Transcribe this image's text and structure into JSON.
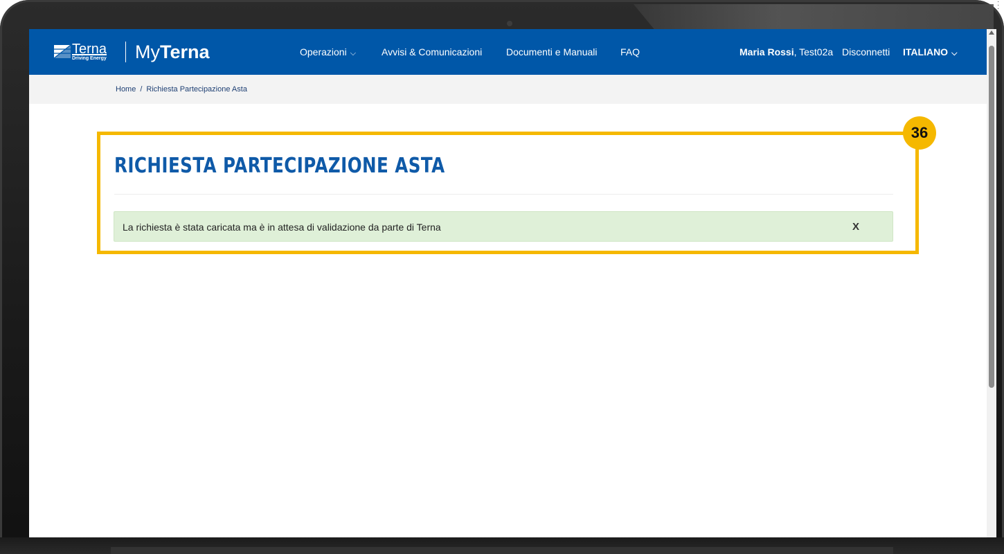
{
  "brand": {
    "logo_name": "Terna",
    "logo_tagline": "Driving Energy",
    "portal_prefix": "My",
    "portal_name": "Terna"
  },
  "nav": {
    "items": [
      {
        "label": "Operazioni",
        "has_dropdown": true
      },
      {
        "label": "Avvisi & Comunicazioni"
      },
      {
        "label": "Documenti e Manuali"
      },
      {
        "label": "FAQ"
      }
    ],
    "user_name": "Maria Rossi",
    "user_account": ", Test02a",
    "logout_label": "Disconnetti",
    "language_label": "ITALIANO"
  },
  "breadcrumb": {
    "items": [
      "Home",
      "Richiesta Partecipazione Asta"
    ],
    "separator": "/"
  },
  "main": {
    "title": "RICHIESTA PARTECIPAZIONE ASTA",
    "alert_message": "La richiesta è stata caricata ma è in attesa di validazione da parte di Terna",
    "alert_close_label": "X"
  },
  "annotation": {
    "step_number": "36"
  },
  "colors": {
    "header_blue": "#0057a8",
    "title_blue": "#0f5aa8",
    "highlight_yellow": "#f5b800",
    "alert_green_bg": "#dff0d8"
  },
  "icons": [
    "terna-logo-icon",
    "chevron-down-icon",
    "close-icon",
    "scroll-up-arrow-icon"
  ]
}
